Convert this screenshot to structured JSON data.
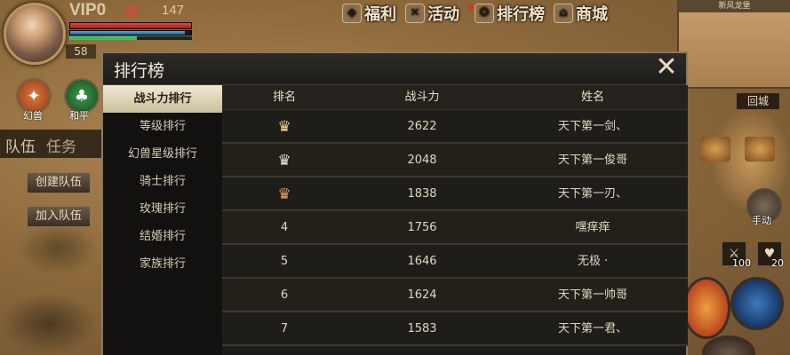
{
  "hud": {
    "vip": "VIP0",
    "power_icon": "战",
    "power": "147",
    "level": "58",
    "hp_fraction": 1.0,
    "mp_fraction": 0.95,
    "exp_fraction": 0.55,
    "pet_label": "幻兽",
    "peace_label": "和平",
    "side_tabs": [
      "队伍",
      "任务"
    ],
    "create_team": "创建队伍",
    "join_team": "加入队伍",
    "top_menu": [
      {
        "label": "福利",
        "icon": "gift-icon"
      },
      {
        "label": "活动",
        "icon": "swords-icon"
      },
      {
        "label": "排行榜",
        "icon": "ranking-icon"
      },
      {
        "label": "商城",
        "icon": "shop-icon"
      }
    ],
    "minimap_title": "新风龙堡",
    "return_label": "回城",
    "manual_label": "手动",
    "item_counts": [
      "100",
      "20"
    ]
  },
  "panel": {
    "title": "排行榜",
    "categories": [
      "战斗力排行",
      "等级排行",
      "幻兽星级排行",
      "骑士排行",
      "玫瑰排行",
      "结婚排行",
      "家族排行"
    ],
    "selected_category": "战斗力排行",
    "columns": [
      "排名",
      "战斗力",
      "姓名"
    ],
    "rows": [
      {
        "rank": "",
        "crown": "gold",
        "power": "2622",
        "name": "天下第一剑、"
      },
      {
        "rank": "",
        "crown": "silver",
        "power": "2048",
        "name": "天下第一俊哥"
      },
      {
        "rank": "",
        "crown": "bronze",
        "power": "1838",
        "name": "天下第一刃、"
      },
      {
        "rank": "4",
        "power": "1756",
        "name": "嘿痒痒"
      },
      {
        "rank": "5",
        "power": "1646",
        "name": "无极 ·"
      },
      {
        "rank": "6",
        "power": "1624",
        "name": "天下第一帅哥"
      },
      {
        "rank": "7",
        "power": "1583",
        "name": "天下第一君、"
      }
    ]
  },
  "colors": {
    "panel_bg": "#1d1b19",
    "panel_border": "#8b7a5c",
    "selected_tab": "#e8dfc6",
    "crown_gold": "#f2d48a",
    "crown_silver": "#e6e6e6",
    "crown_bronze": "#e89a6a"
  }
}
